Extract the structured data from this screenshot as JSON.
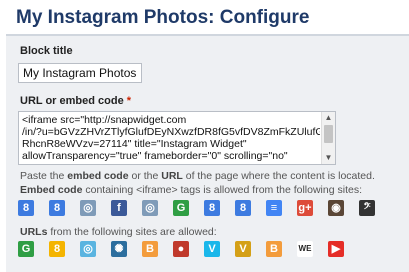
{
  "header": {
    "title": "My Instagram Photos: Configure"
  },
  "block_title": {
    "label": "Block title",
    "value": "My Instagram Photos"
  },
  "embed": {
    "label": "URL or embed code",
    "required_mark": "*",
    "lines": [
      "<iframe src=\"http://snapwidget.com",
      "/in/?u=bGVzZHVrZTlyfGlufDEyNXwzfDR8fG5vfDV8ZmFkZUlufG9uU3",
      "RhcnR8eWVzv=27114\" title=\"Instagram Widget\"",
      "allowTransparency=\"true\" frameborder=\"0\" scrolling=\"no\""
    ]
  },
  "help": {
    "line1_pre": "Paste the ",
    "line1_b1": "embed code",
    "line1_mid": " or the ",
    "line1_b2": "URL",
    "line1_post": " of the page where the content is located.",
    "line2_b1": "Embed code",
    "line2_post": " containing <iframe> tags is allowed from the following sites:",
    "line3_b1": "URLs",
    "line3_post": " from the following sites are allowed:"
  },
  "colors": {
    "header_text": "#1f3a68",
    "panel_bg": "#eef0f3",
    "required": "#cc2200"
  },
  "embed_sites": [
    {
      "icon": "google-icon",
      "glyph": "8",
      "color": "#3d7be0"
    },
    {
      "icon": "google-icon",
      "glyph": "8",
      "color": "#3d7be0"
    },
    {
      "icon": "globe-icon",
      "glyph": "◎",
      "color": "#7f9bb8"
    },
    {
      "icon": "facebook-icon",
      "glyph": "f",
      "color": "#3b5998"
    },
    {
      "icon": "globe-icon",
      "glyph": "◎",
      "color": "#7f9bb8"
    },
    {
      "icon": "google-calendar-icon",
      "glyph": "G",
      "color": "#2f9e44"
    },
    {
      "icon": "google-icon",
      "glyph": "8",
      "color": "#3d7be0"
    },
    {
      "icon": "google-icon",
      "glyph": "8",
      "color": "#3d7be0"
    },
    {
      "icon": "google-docs-icon",
      "glyph": "≡",
      "color": "#4285f4"
    },
    {
      "icon": "google-plus-icon",
      "glyph": "g+",
      "color": "#dd4b39"
    },
    {
      "icon": "instagram-icon",
      "glyph": "◉",
      "color": "#5a4636"
    },
    {
      "icon": "music-icon",
      "glyph": "𝄢",
      "color": "#333333"
    }
  ],
  "url_sites": [
    {
      "icon": "google-maps-icon",
      "glyph": "G",
      "color": "#2f9e44"
    },
    {
      "icon": "google-icon",
      "glyph": "8",
      "color": "#f4b400"
    },
    {
      "icon": "globe-icon",
      "glyph": "◎",
      "color": "#5ab4e0"
    },
    {
      "icon": "nasa-icon",
      "glyph": "✺",
      "color": "#2c6e9e"
    },
    {
      "icon": "blogger-icon",
      "glyph": "B",
      "color": "#f39c3c"
    },
    {
      "icon": "apple-icon",
      "glyph": "●",
      "color": "#c0392b"
    },
    {
      "icon": "vimeo-icon",
      "glyph": "V",
      "color": "#1ab7ea"
    },
    {
      "icon": "vine-icon",
      "glyph": "V",
      "color": "#d4a017"
    },
    {
      "icon": "blogger-icon",
      "glyph": "B",
      "color": "#f39c3c"
    },
    {
      "icon": "we-icon",
      "glyph": "WE",
      "color": "#ffffff"
    },
    {
      "icon": "youtube-icon",
      "glyph": "▶",
      "color": "#e52d27"
    }
  ]
}
